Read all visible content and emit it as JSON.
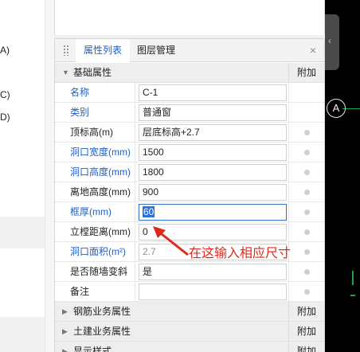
{
  "left_labels": [
    "A)",
    "C)",
    "D)"
  ],
  "tabs": [
    {
      "label": "属性列表",
      "active": true
    },
    {
      "label": "图层管理",
      "active": false
    }
  ],
  "close_glyph": "×",
  "attach_header": "附加",
  "groups": {
    "basic": "基础属性",
    "rebar": "钢筋业务属性",
    "civil": "土建业务属性",
    "display": "显示样式"
  },
  "properties": [
    {
      "name": "名称",
      "value": "C-1",
      "blue": true
    },
    {
      "name": "类别",
      "value": "普通窗",
      "blue": true
    },
    {
      "name": "顶标高(m)",
      "value": "层底标高+2.7",
      "blue": false
    },
    {
      "name": "洞口宽度(mm)",
      "value": "1500",
      "blue": true
    },
    {
      "name": "洞口高度(mm)",
      "value": "1800",
      "blue": true
    },
    {
      "name": "离地高度(mm)",
      "value": "900",
      "blue": false
    },
    {
      "name": "框厚(mm)",
      "value": "60",
      "blue": true,
      "editing": true
    },
    {
      "name": "立樘距离(mm)",
      "value": "0",
      "blue": false
    },
    {
      "name": "洞口面积(m²)",
      "value": "2.7",
      "blue": true,
      "readonly": true
    },
    {
      "name": "是否随墙变斜",
      "value": "是",
      "blue": false
    },
    {
      "name": "备注",
      "value": "",
      "blue": false
    }
  ],
  "annotation": "在这输入相应尺寸",
  "canvas": {
    "axis_label": "A",
    "collapse_glyph": "‹"
  },
  "colors": {
    "accent_blue": "#1f5fbf",
    "annotation_red": "#e0281c",
    "axis_green": "#1aa84a"
  }
}
